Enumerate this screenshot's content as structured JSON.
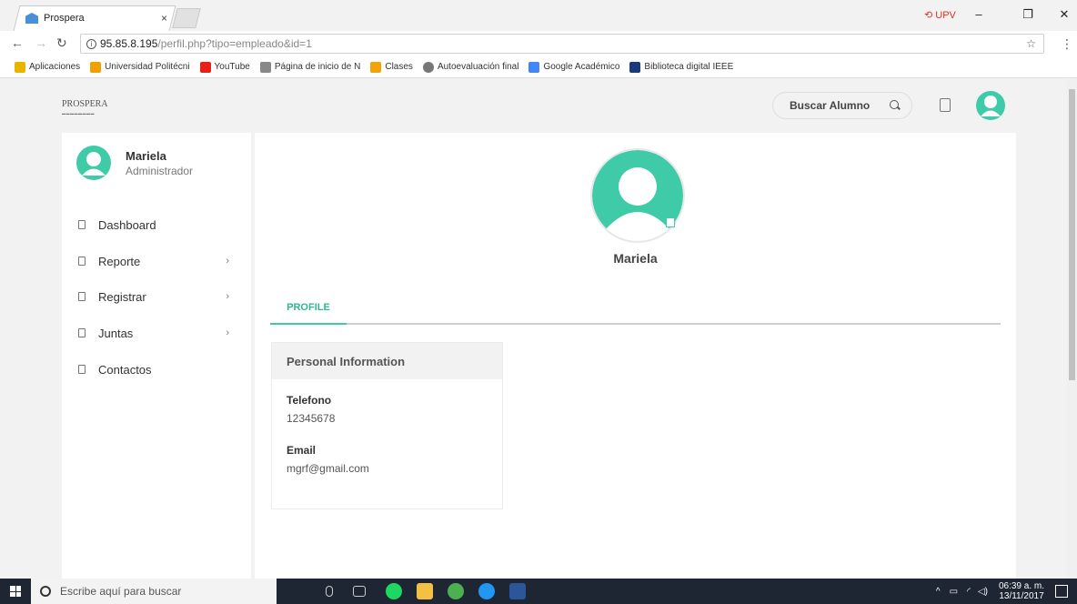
{
  "browser": {
    "tab_title": "Prospera",
    "tab_close": "×",
    "extension_label": "UPV",
    "url_host": "95.85.8.195",
    "url_path": "/perfil.php?tipo=empleado&id=1",
    "bookmarks": [
      {
        "label": "Aplicaciones",
        "color": "#e8b400"
      },
      {
        "label": "Universidad Politécni",
        "color": "#f0a000"
      },
      {
        "label": "YouTube",
        "color": "#e62117"
      },
      {
        "label": "Página de inicio de N",
        "color": "#888888"
      },
      {
        "label": "Clases",
        "color": "#f2a20c"
      },
      {
        "label": "Autoevaluación final",
        "color": "#777777"
      },
      {
        "label": "Google Académico",
        "color": "#4285f4"
      },
      {
        "label": "Biblioteca digital IEEE",
        "color": "#1a3a7a"
      }
    ]
  },
  "header": {
    "logo_text": "PROSPERA",
    "search_label": "Buscar Alumno"
  },
  "sidebar": {
    "user_name": "Mariela",
    "user_role": "Administrador",
    "items": [
      {
        "label": "Dashboard",
        "has_submenu": false
      },
      {
        "label": "Reporte",
        "has_submenu": true
      },
      {
        "label": "Registrar",
        "has_submenu": true
      },
      {
        "label": "Juntas",
        "has_submenu": true
      },
      {
        "label": "Contactos",
        "has_submenu": false
      }
    ],
    "chevron": "›"
  },
  "profile": {
    "name": "Mariela",
    "tab_label": "PROFILE",
    "card_title": "Personal Information",
    "phone_label": "Telefono",
    "phone_value": "12345678",
    "email_label": "Email",
    "email_value": "mgrf@gmail.com"
  },
  "taskbar": {
    "search_placeholder": "Escribe aquí para buscar",
    "time": "06:39 a. m.",
    "date": "13/11/2017"
  },
  "colors": {
    "accent": "#3fcba8",
    "taskbar": "#1e2633"
  }
}
